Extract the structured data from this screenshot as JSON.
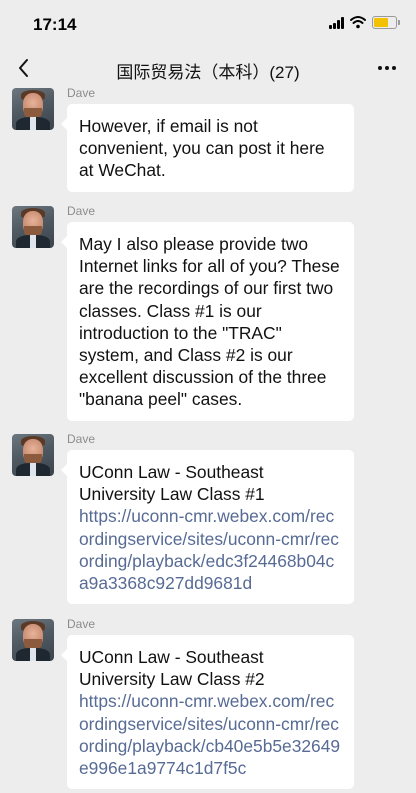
{
  "status_bar": {
    "time": "17:14",
    "icons": [
      "signal-icon",
      "wifi-icon",
      "battery-icon"
    ],
    "battery_color": "#f2c200"
  },
  "nav": {
    "back_icon": "chevron-left-icon",
    "title": "国际贸易法（本科）(27)",
    "more_icon": "more-dots-icon"
  },
  "messages": [
    {
      "sender": "Dave",
      "text": "However, if email is not convenient, you can post it here at WeChat."
    },
    {
      "sender": "Dave",
      "text": "May I also please provide two Internet links for all of you? These are the recordings of our first two classes. Class #1 is our introduction to the \"TRAC\" system, and Class #2 is our excellent discussion of the three  \"banana peel\" cases."
    },
    {
      "sender": "Dave",
      "title": "UConn Law - Southeast University Law Class #1",
      "link": "https://uconn-cmr.webex.com/recordingservice/sites/uconn-cmr/recording/playback/edc3f24468b04ca9a3368c927dd9681d"
    },
    {
      "sender": "Dave",
      "title": "UConn Law - Southeast University Law Class #2",
      "link": "https://uconn-cmr.webex.com/recordingservice/sites/uconn-cmr/recording/playback/cb40e5b5e32649e996e1a9774c1d7f5c"
    }
  ],
  "colors": {
    "background": "#ededed",
    "bubble": "#ffffff",
    "link": "#576b95",
    "sender_name": "#8c8c8c"
  }
}
